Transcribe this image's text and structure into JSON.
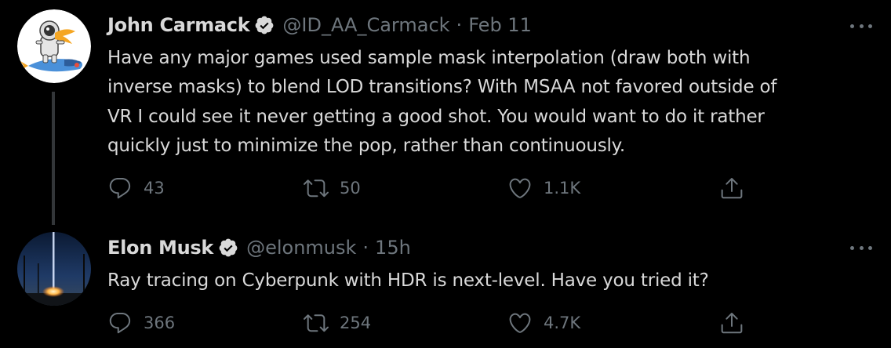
{
  "colors": {
    "background": "#000000",
    "text": "#d9d9d9",
    "muted": "#6e767d",
    "thread_line": "#333639",
    "verified_badge": "#d9d9d9"
  },
  "tweets": [
    {
      "display_name": "John Carmack",
      "verified_icon": "verified-badge-icon",
      "handle": "@ID_AA_Carmack",
      "separator": "·",
      "time": "Feb 11",
      "text": "Have any major games used sample mask interpolation (draw both with\ninverse masks) to blend LOD transitions? With MSAA not favored outside of\nVR I could see it never getting a good shot. You would want to do it rather\nquickly just to minimize the pop, rather than continuously.",
      "replies": "43",
      "retweets": "50",
      "likes": "1.1K",
      "avatar_icon": "cartoon-astronaut-rocket-avatar"
    },
    {
      "display_name": "Elon Musk",
      "verified_icon": "verified-badge-icon",
      "handle": "@elonmusk",
      "separator": "·",
      "time": "15h",
      "text": "Ray tracing on Cyberpunk with HDR is next-level. Have you tried it?",
      "replies": "366",
      "retweets": "254",
      "likes": "4.7K",
      "avatar_icon": "rocket-launch-photo-avatar"
    }
  ],
  "icons": {
    "reply": "reply-icon",
    "retweet": "retweet-icon",
    "like": "like-icon",
    "share": "share-icon",
    "more": "more-options-icon"
  }
}
